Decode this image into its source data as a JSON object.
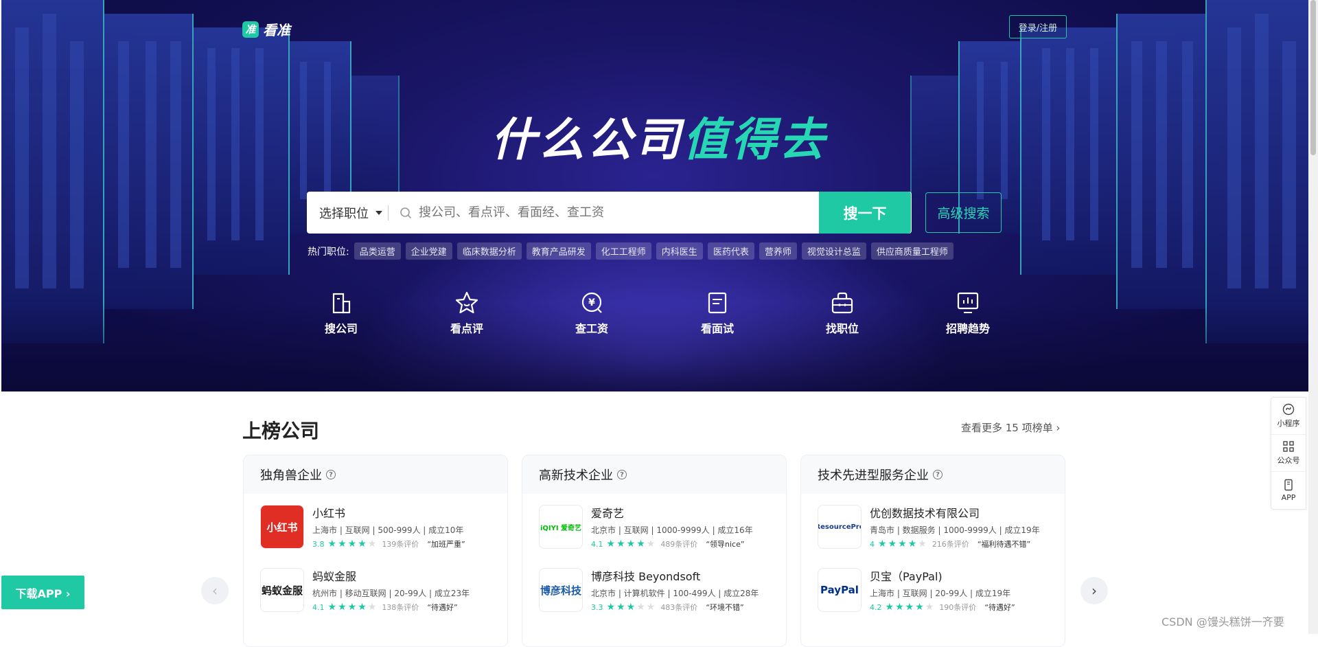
{
  "header": {
    "logo_mark": "准",
    "logo_text": "看准",
    "login_label": "登录/注册"
  },
  "hero": {
    "slogan_white": "什么公司",
    "slogan_green": "值得去"
  },
  "search": {
    "category_label": "选择职位",
    "placeholder": "搜公司、看点评、看面经、查工资",
    "button_label": "搜一下",
    "advanced_label": "高级搜索"
  },
  "hot_jobs": {
    "label": "热门职位:",
    "tags": [
      "品类运营",
      "企业党建",
      "临床数据分析",
      "教育产品研发",
      "化工工程师",
      "内科医生",
      "医药代表",
      "营养师",
      "视觉设计总监",
      "供应商质量工程师"
    ]
  },
  "features": [
    {
      "label": "搜公司",
      "icon": "building-icon"
    },
    {
      "label": "看点评",
      "icon": "star-icon"
    },
    {
      "label": "查工资",
      "icon": "salary-icon"
    },
    {
      "label": "看面试",
      "icon": "document-icon"
    },
    {
      "label": "找职位",
      "icon": "briefcase-icon"
    },
    {
      "label": "招聘趋势",
      "icon": "trend-chart-icon"
    }
  ],
  "side_bar": [
    {
      "label": "小程序",
      "icon": "mini-program-icon"
    },
    {
      "label": "公众号",
      "icon": "qrcode-icon"
    },
    {
      "label": "APP",
      "icon": "phone-icon"
    }
  ],
  "download_app": "下载APP ›",
  "ranking": {
    "title": "上榜公司",
    "more_label": "查看更多 15 项榜单",
    "cards": [
      {
        "title": "独角兽企业",
        "companies": [
          {
            "name": "小红书",
            "logo_text": "小红书",
            "logo_bg": "#e02e24",
            "logo_color": "#ffffff",
            "meta": "上海市 | 互联网 | 500-999人 | 成立10年",
            "score": "3.8",
            "stars": 4,
            "reviews": "139条评价",
            "quote": "“加班严重”"
          },
          {
            "name": "蚂蚁金服",
            "logo_text": "蚂蚁金服",
            "logo_bg": "#ffffff",
            "logo_color": "#1a1a1a",
            "meta": "杭州市 | 移动互联网 | 20-99人 | 成立23年",
            "score": "4.1",
            "stars": 4,
            "reviews": "138条评价",
            "quote": "“待遇好”"
          }
        ]
      },
      {
        "title": "高新技术企业",
        "companies": [
          {
            "name": "爱奇艺",
            "logo_text": "iQIYI 爱奇艺",
            "logo_bg": "#ffffff",
            "logo_color": "#00be06",
            "meta": "北京市 | 互联网 | 1000-9999人 | 成立16年",
            "score": "4.1",
            "stars": 4,
            "reviews": "489条评价",
            "quote": "“领导nice”"
          },
          {
            "name": "博彦科技 Beyondsoft",
            "logo_text": "博彦科技",
            "logo_bg": "#ffffff",
            "logo_color": "#1c5ba8",
            "meta": "北京市 | 计算机软件 | 100-499人 | 成立28年",
            "score": "3.3",
            "stars": 3,
            "reviews": "483条评价",
            "quote": "“环境不错”"
          }
        ]
      },
      {
        "title": "技术先进型服务企业",
        "companies": [
          {
            "name": "优创数据技术有限公司",
            "logo_text": "ResourcePro",
            "logo_bg": "#ffffff",
            "logo_color": "#1c3c8a",
            "meta": "青岛市 | 数据服务 | 1000-9999人 | 成立19年",
            "score": "4",
            "stars": 4,
            "reviews": "216条评价",
            "quote": "“福利待遇不错”"
          },
          {
            "name": "贝宝（PayPal)",
            "logo_text": "PayPal",
            "logo_bg": "#ffffff",
            "logo_color": "#003087",
            "meta": "上海市 | 互联网 | 20-99人 | 成立19年",
            "score": "4.2",
            "stars": 4,
            "reviews": "190条评价",
            "quote": "“待遇好”"
          }
        ]
      }
    ]
  },
  "watermark": "CSDN @馒头糕饼一齐要"
}
